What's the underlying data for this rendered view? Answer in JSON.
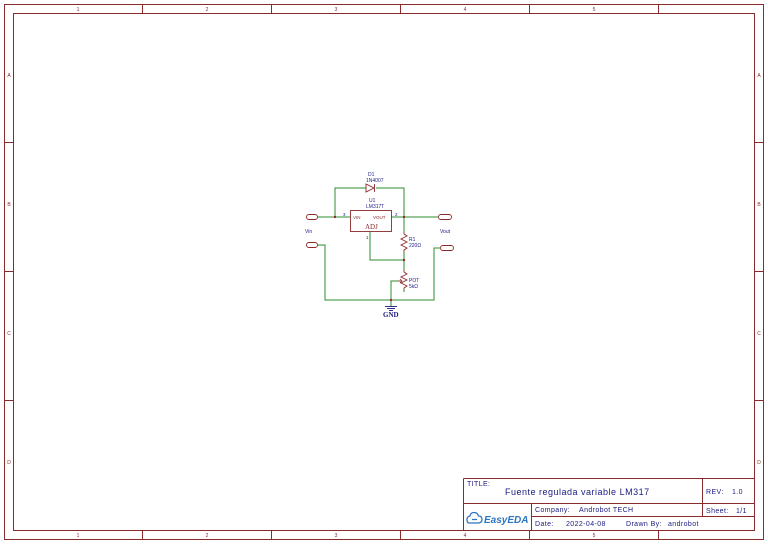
{
  "frame": {
    "columns": [
      "1",
      "2",
      "3",
      "4",
      "5"
    ],
    "rows": [
      "A",
      "B",
      "C",
      "D"
    ]
  },
  "components": {
    "d1": {
      "ref": "D1",
      "value": "1N4007"
    },
    "u1": {
      "ref": "U1",
      "value": "LM317T",
      "pin_vin": "VIN",
      "pin_vout": "VOUT",
      "pin_adj": "ADJ",
      "pin3": "3",
      "pin2": "2",
      "pin1": "1"
    },
    "r1": {
      "ref": "R1",
      "value": "220Ω"
    },
    "pot": {
      "ref": "POT",
      "value": "5kΩ"
    }
  },
  "nets": {
    "vin": "Vin",
    "vout": "Vout",
    "gnd": "GND"
  },
  "titleblock": {
    "title_label": "TITLE:",
    "title": "Fuente regulada variable LM317",
    "rev_label": "REV:",
    "rev": "1.0",
    "company_label": "Company:",
    "company": "Androbot TECH",
    "sheet_label": "Sheet:",
    "sheet": "1/1",
    "date_label": "Date:",
    "date": "2022-04-08",
    "drawn_label": "Drawn By:",
    "drawn_by": "androbot",
    "logo": "EasyEDA"
  },
  "colors": {
    "frame": "#8b2a2a",
    "wire": "#2e8b2e",
    "label": "#1a1a80",
    "logo": "#2b76c0"
  }
}
